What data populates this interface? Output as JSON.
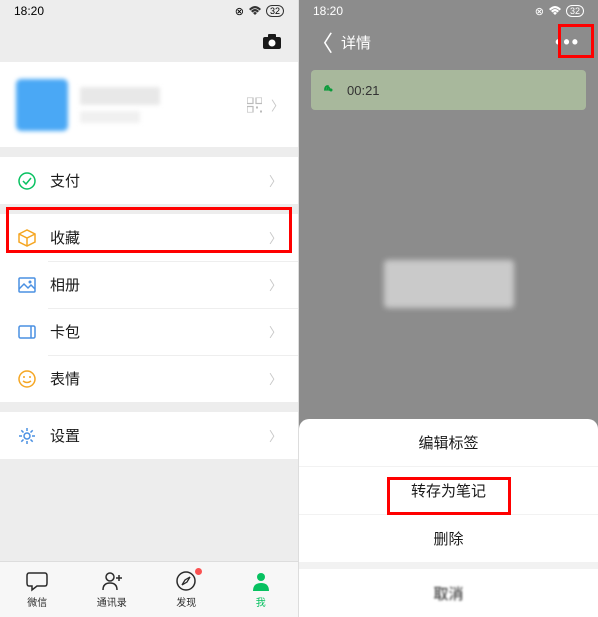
{
  "status": {
    "time": "18:20",
    "battery": "32"
  },
  "left": {
    "menu": {
      "pay": "支付",
      "fav": "收藏",
      "album": "相册",
      "cards": "卡包",
      "sticker": "表情",
      "settings": "设置"
    },
    "tabs": {
      "wechat": "微信",
      "contacts": "通讯录",
      "discover": "发现",
      "me": "我"
    }
  },
  "right": {
    "title": "详情",
    "voice_time": "00:21",
    "sheet": {
      "edit_tag": "编辑标签",
      "to_note": "转存为笔记",
      "delete": "删除",
      "cancel": "取消"
    }
  }
}
